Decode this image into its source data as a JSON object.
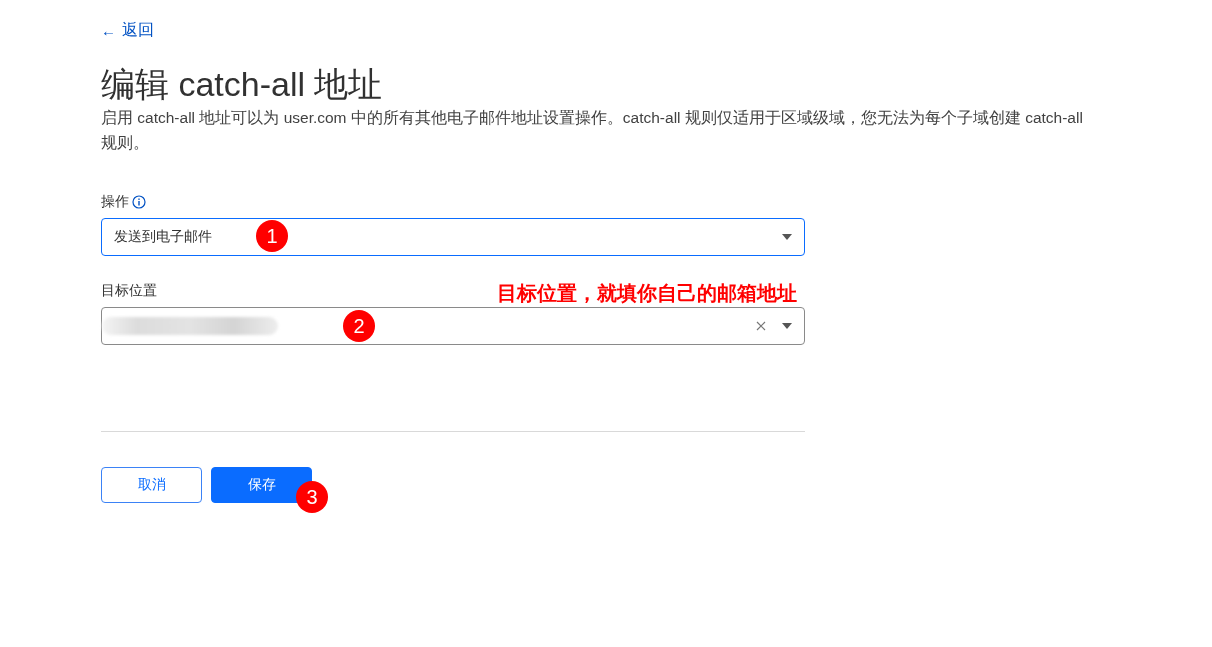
{
  "back_link": {
    "arrow": "←",
    "label": "返回"
  },
  "title": "编辑 catch-all 地址",
  "description": [
    "启用 catch-all 地址可以为 user.com 中的所有其他电子邮件地址设置操作。catch-all 规则仅适用于区域级域，您无法为每个子域创建 catch-all",
    "规则。"
  ],
  "fields": [
    {
      "kind": "select",
      "label": "操作",
      "info": true,
      "value": "发送到电子邮件",
      "focused": true,
      "clearable": false,
      "marker": "1"
    },
    {
      "kind": "select",
      "label": "目标位置",
      "info": false,
      "value_redacted": true,
      "focused": false,
      "clearable": true,
      "marker": "2",
      "annotation": "目标位置，就填你自己的邮箱地址"
    }
  ],
  "buttons": [
    {
      "label": "取消",
      "kind": "secondary"
    },
    {
      "label": "保存",
      "kind": "primary",
      "marker": "3"
    }
  ]
}
